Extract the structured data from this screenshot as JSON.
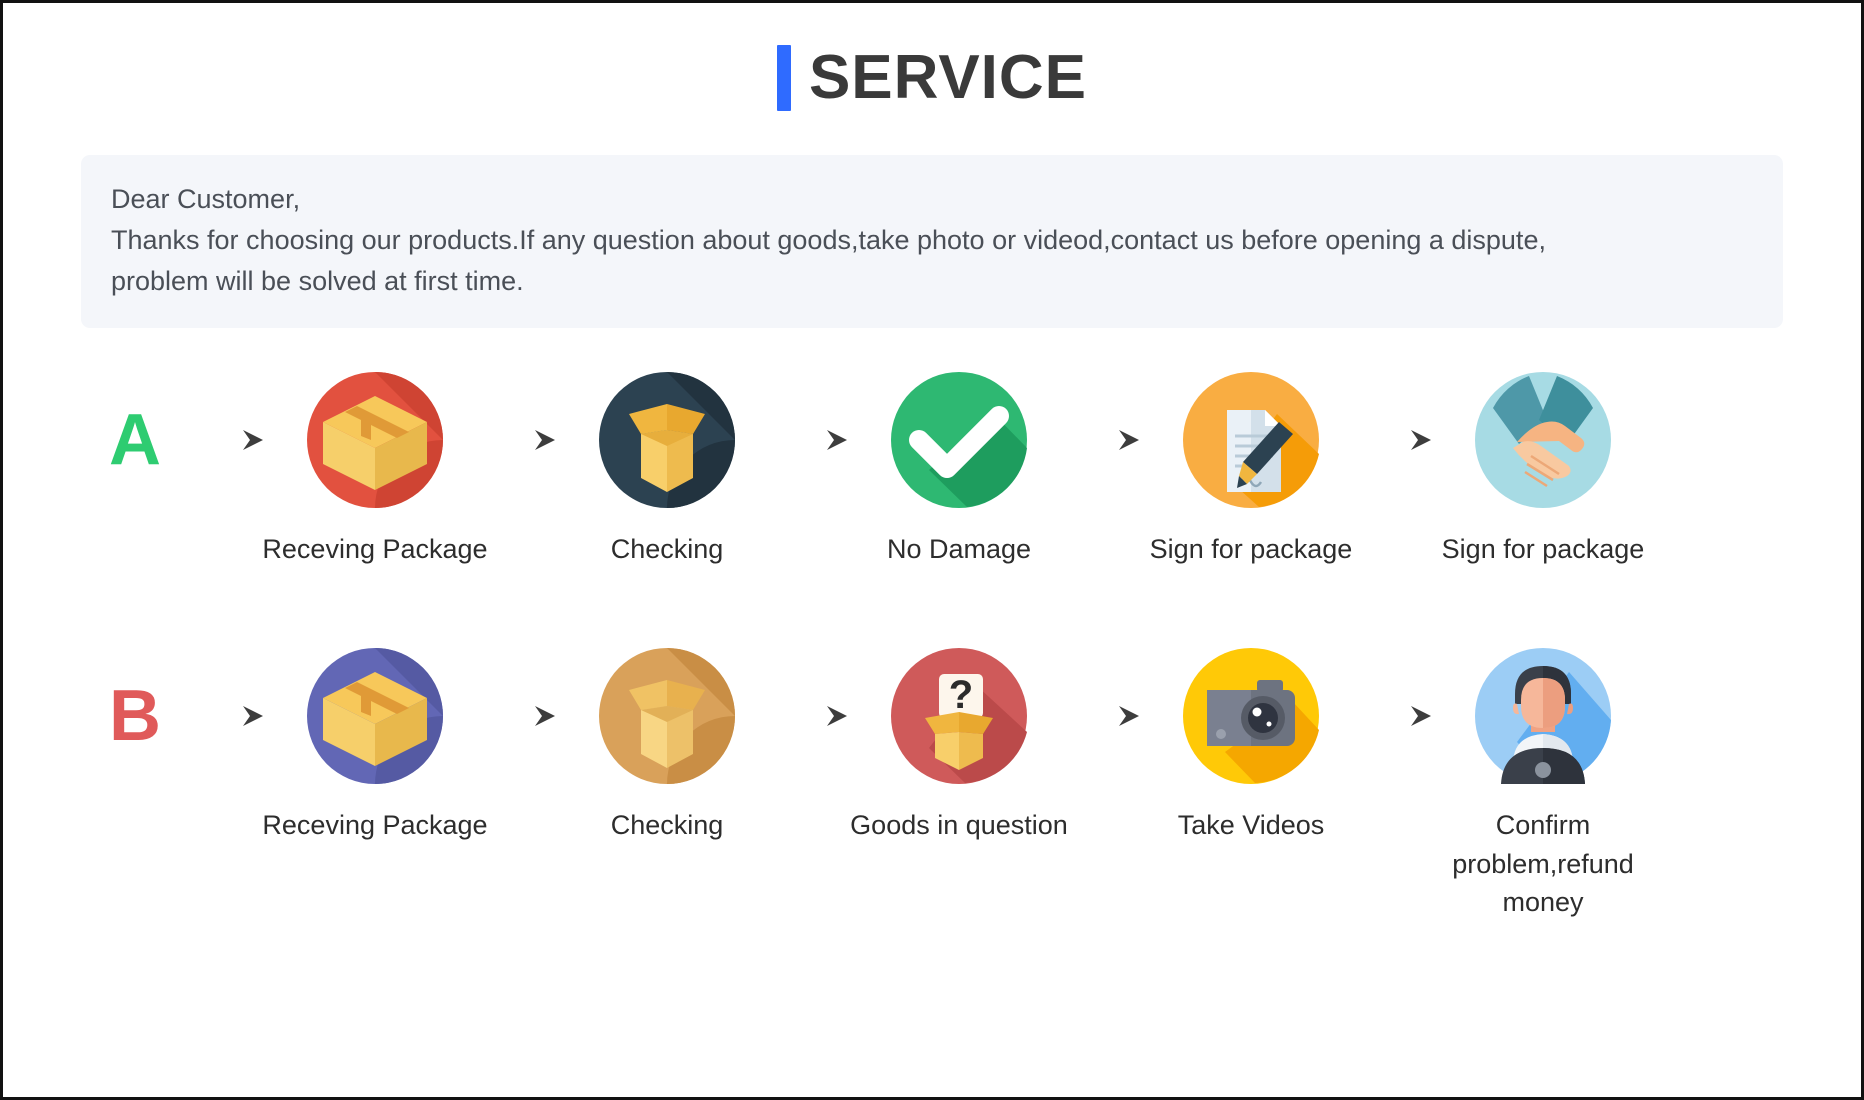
{
  "header": {
    "title": "SERVICE",
    "accent_color": "#2f6bff",
    "title_color": "#3a3a3a"
  },
  "notice": {
    "background": "#f4f6fa",
    "lines": [
      "Dear Customer,",
      "Thanks for choosing our products.If any question about goods,take photo or videod,contact us before opening a dispute,",
      "problem will be solved at first time."
    ]
  },
  "flows": [
    {
      "letter": "A",
      "letter_color": "#2ecc71",
      "steps": [
        {
          "label": "Receving Package",
          "icon": "closed-box-icon",
          "circle_color": "#e2513f",
          "circle_shadow": "#cf4433"
        },
        {
          "label": "Checking",
          "icon": "open-box-icon",
          "circle_color": "#2c4251",
          "circle_shadow": "#22333f"
        },
        {
          "label": "No Damage",
          "icon": "check-mark-icon",
          "circle_color": "#2eb872",
          "circle_shadow": "#1e9d5e"
        },
        {
          "label": "Sign for package",
          "icon": "document-pen-icon",
          "circle_color": "#f9ad42",
          "circle_shadow": "#f59c08"
        },
        {
          "label": "Sign for package",
          "icon": "handshake-icon",
          "circle_color": "#a7dbe4",
          "circle_shadow": "#97d2dd"
        }
      ]
    },
    {
      "letter": "B",
      "letter_color": "#e05a5a",
      "steps": [
        {
          "label": "Receving Package",
          "icon": "closed-box-icon",
          "circle_color": "#6267b5",
          "circle_shadow": "#555aa3"
        },
        {
          "label": "Checking",
          "icon": "open-box-icon",
          "circle_color": "#d9a15a",
          "circle_shadow": "#c98e45"
        },
        {
          "label": "Goods in question",
          "icon": "question-box-icon",
          "circle_color": "#cf5a5a",
          "circle_shadow": "#bb4a4a"
        },
        {
          "label": "Take Videos",
          "icon": "camera-icon",
          "circle_color": "#ffc907",
          "circle_shadow": "#f5a700"
        },
        {
          "label": "Confirm problem,refund money",
          "icon": "support-agent-icon",
          "circle_color": "#9ccdf5",
          "circle_shadow": "#62aef0"
        }
      ]
    }
  ],
  "arrow": {
    "name": "right-arrow-icon",
    "color": "#4a4a4a"
  }
}
